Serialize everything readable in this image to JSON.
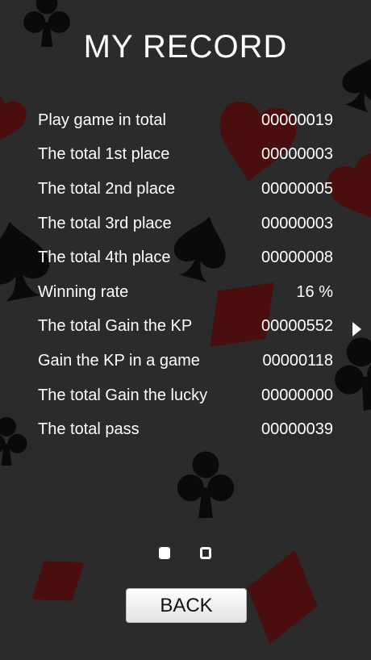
{
  "screen": {
    "title": "MY RECORD",
    "colors": {
      "background": "#2b2b2b",
      "suit_black": "#0a0a0a",
      "suit_red": "#4a0e0e"
    }
  },
  "stats": [
    {
      "label": "Play game in total",
      "value": "00000019"
    },
    {
      "label": "The total 1st place",
      "value": "00000003"
    },
    {
      "label": "The total 2nd place",
      "value": "00000005"
    },
    {
      "label": "The total 3rd place",
      "value": "00000003"
    },
    {
      "label": "The total 4th place",
      "value": "00000008"
    },
    {
      "label": "Winning rate",
      "value": "16 %"
    },
    {
      "label": "The total Gain the KP",
      "value": "00000552"
    },
    {
      "label": "Gain the KP in a game",
      "value": "00000118"
    },
    {
      "label": "The total Gain the lucky",
      "value": "00000000"
    },
    {
      "label": "The total pass",
      "value": "00000039"
    }
  ],
  "pagination": {
    "pages": 2,
    "current": 1
  },
  "icons": {
    "next": "arrow-right-icon",
    "background": [
      "spade-icon",
      "heart-icon",
      "diamond-icon",
      "club-icon"
    ]
  },
  "actions": {
    "back_label": "BACK"
  }
}
